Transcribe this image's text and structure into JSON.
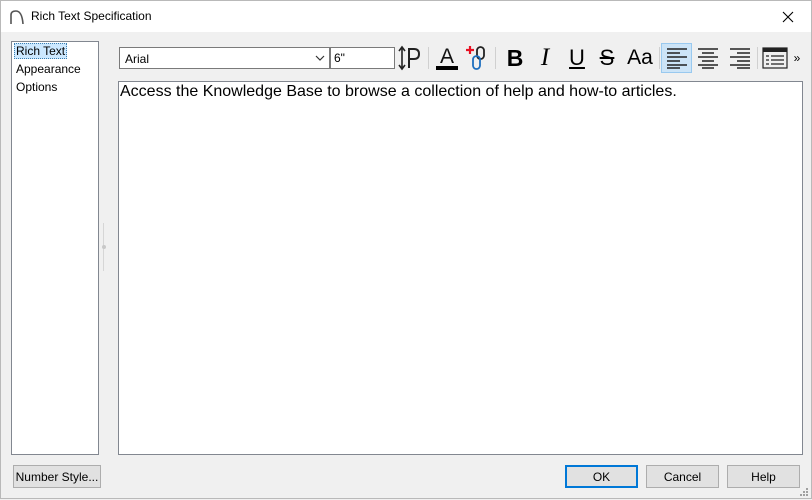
{
  "window": {
    "title": "Rich Text Specification"
  },
  "nav": {
    "items": [
      {
        "label": "Rich Text",
        "selected": true
      },
      {
        "label": "Appearance",
        "selected": false
      },
      {
        "label": "Options",
        "selected": false
      }
    ]
  },
  "toolbar": {
    "font_family": "Arial",
    "font_size": "6\"",
    "buttons": [
      {
        "name": "line-spacing",
        "icon": "line-spacing-icon",
        "glyph": "↕P"
      },
      {
        "name": "text-color",
        "icon": "font-color-icon",
        "glyph": "A"
      },
      {
        "name": "hyperlink",
        "icon": "add-link-icon",
        "glyph": ""
      },
      {
        "name": "bold",
        "icon": "bold-icon",
        "glyph": "B"
      },
      {
        "name": "italic",
        "icon": "italic-icon",
        "glyph": "I"
      },
      {
        "name": "underline",
        "icon": "underline-icon",
        "glyph": "U"
      },
      {
        "name": "strikethrough",
        "icon": "strikethrough-icon",
        "glyph": "S"
      },
      {
        "name": "change-case",
        "icon": "change-case-icon",
        "glyph": "Aa"
      },
      {
        "name": "align-left",
        "icon": "align-left-icon",
        "active": true
      },
      {
        "name": "align-center",
        "icon": "align-center-icon"
      },
      {
        "name": "align-right",
        "icon": "align-right-icon"
      },
      {
        "name": "list",
        "icon": "bulleted-list-icon"
      },
      {
        "name": "overflow",
        "icon": "chevron-double-right-icon",
        "glyph": "»"
      }
    ]
  },
  "editor": {
    "content": "Access the Knowledge Base to browse a collection of help and how-to articles."
  },
  "footer": {
    "number_style_label": "Number Style...",
    "ok_label": "OK",
    "cancel_label": "Cancel",
    "help_label": "Help"
  },
  "colors": {
    "accent": "#0078d7",
    "selection": "#cce8ff",
    "active_button": "#cce4f7",
    "link_plus": "#e81123",
    "link_chain": "#1e6fbf"
  }
}
